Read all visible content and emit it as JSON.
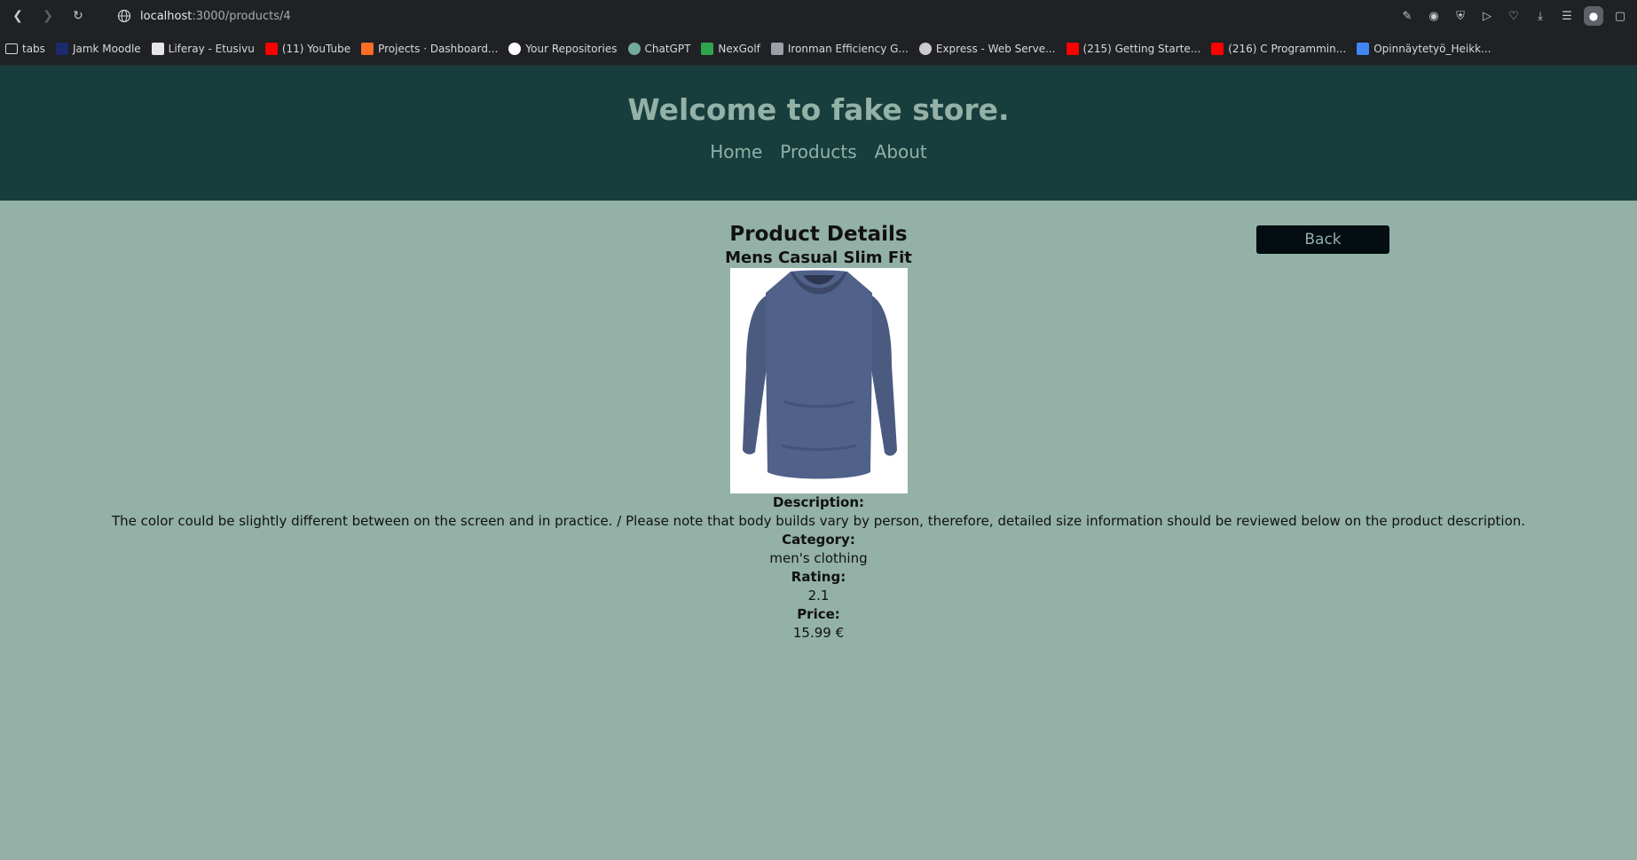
{
  "browser": {
    "url_host": "localhost",
    "url_path": ":3000/products/4",
    "bookmarks": [
      {
        "label": "tabs",
        "icon": "folder-icon",
        "color": "#d7d9dd"
      },
      {
        "label": "Jamk Moodle",
        "icon": "jamk-icon",
        "color": "#1b2a6b"
      },
      {
        "label": "Liferay - Etusivu",
        "icon": "document-icon",
        "color": "#e6e6e6"
      },
      {
        "label": "(11) YouTube",
        "icon": "youtube-icon",
        "color": "#ff0000"
      },
      {
        "label": "Projects · Dashboard...",
        "icon": "gitlab-icon",
        "color": "#fc6d26"
      },
      {
        "label": "Your Repositories",
        "icon": "github-icon",
        "color": "#ffffff"
      },
      {
        "label": "ChatGPT",
        "icon": "chatgpt-icon",
        "color": "#74aa9c"
      },
      {
        "label": "NexGolf",
        "icon": "nexgolf-icon",
        "color": "#2ea44f"
      },
      {
        "label": "Ironman Efficiency G...",
        "icon": "ironman-icon",
        "color": "#9aa0a6"
      },
      {
        "label": "Express - Web Serve...",
        "icon": "express-icon",
        "color": "#cccccc"
      },
      {
        "label": "(215) Getting Starte...",
        "icon": "youtube-icon",
        "color": "#ff0000"
      },
      {
        "label": "(216) C Programmin...",
        "icon": "youtube-icon",
        "color": "#ff0000"
      },
      {
        "label": "Opinnäytetyö_Heikk...",
        "icon": "docs-icon",
        "color": "#4285f4"
      }
    ]
  },
  "header": {
    "title": "Welcome to fake store.",
    "nav": [
      "Home",
      "Products",
      "About"
    ]
  },
  "main": {
    "back_label": "Back",
    "heading": "Product Details",
    "product_title": "Mens Casual Slim Fit",
    "description_label": "Description:",
    "description": "The color could be slightly different between on the screen and in practice. / Please note that body builds vary by person, therefore, detailed size information should be reviewed below on the product description.",
    "category_label": "Category:",
    "category": "men's clothing",
    "rating_label": "Rating:",
    "rating": "2.1",
    "price_label": "Price:",
    "price": "15.99 €"
  },
  "colors": {
    "page_bg": "#93b1a6",
    "header_bg": "#183d3d",
    "accent_text": "#93b1a6",
    "button_bg": "#040d12",
    "shirt": "#4e5f86"
  }
}
